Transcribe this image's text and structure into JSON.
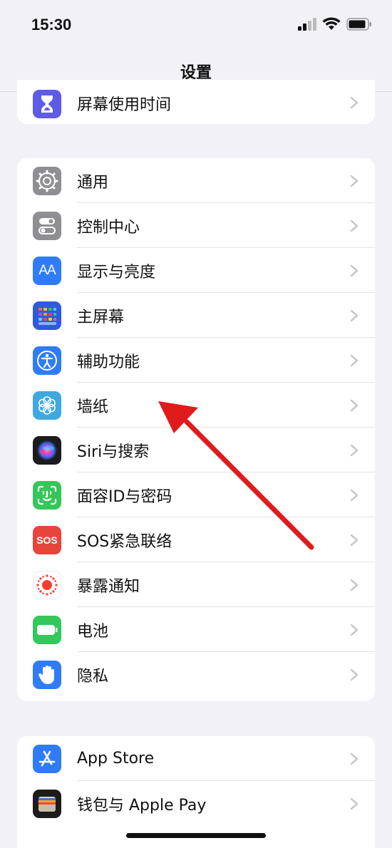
{
  "status": {
    "time": "15:30"
  },
  "nav": {
    "title": "设置"
  },
  "top_group": [
    {
      "label": "屏幕使用时间",
      "icon": "hourglass-icon",
      "color": "#5e5ce6"
    }
  ],
  "main_group": [
    {
      "label": "通用",
      "icon": "gear-icon",
      "color": "#8e8e93"
    },
    {
      "label": "控制中心",
      "icon": "toggles-icon",
      "color": "#8e8e93"
    },
    {
      "label": "显示与亮度",
      "icon": "text-size-icon",
      "color": "#2f7cf6",
      "glyph": "AA"
    },
    {
      "label": "主屏幕",
      "icon": "home-screen-icon",
      "color": "#2f5ae0"
    },
    {
      "label": "辅助功能",
      "icon": "accessibility-icon",
      "color": "#2f7cf6"
    },
    {
      "label": "墙纸",
      "icon": "flower-icon",
      "color": "#3fa8e0"
    },
    {
      "label": "Siri与搜索",
      "icon": "siri-icon",
      "color": "#1c1c1e"
    },
    {
      "label": "面容ID与密码",
      "icon": "face-id-icon",
      "color": "#34c759"
    },
    {
      "label": "SOS紧急联络",
      "icon": "sos-icon",
      "color": "#e5453a",
      "glyph": "SOS"
    },
    {
      "label": "暴露通知",
      "icon": "exposure-icon",
      "color": "#ffffff"
    },
    {
      "label": "电池",
      "icon": "battery-icon",
      "color": "#34c759"
    },
    {
      "label": "隐私",
      "icon": "hand-icon",
      "color": "#2f7cf6"
    }
  ],
  "apps_group": [
    {
      "label": "App Store",
      "icon": "app-store-icon",
      "color": "#2f7cf6"
    },
    {
      "label": "钱包与 Apple Pay",
      "icon": "wallet-icon",
      "color": "#1c1c1e"
    }
  ],
  "annotation": {
    "arrow_color": "#e01b1b"
  }
}
